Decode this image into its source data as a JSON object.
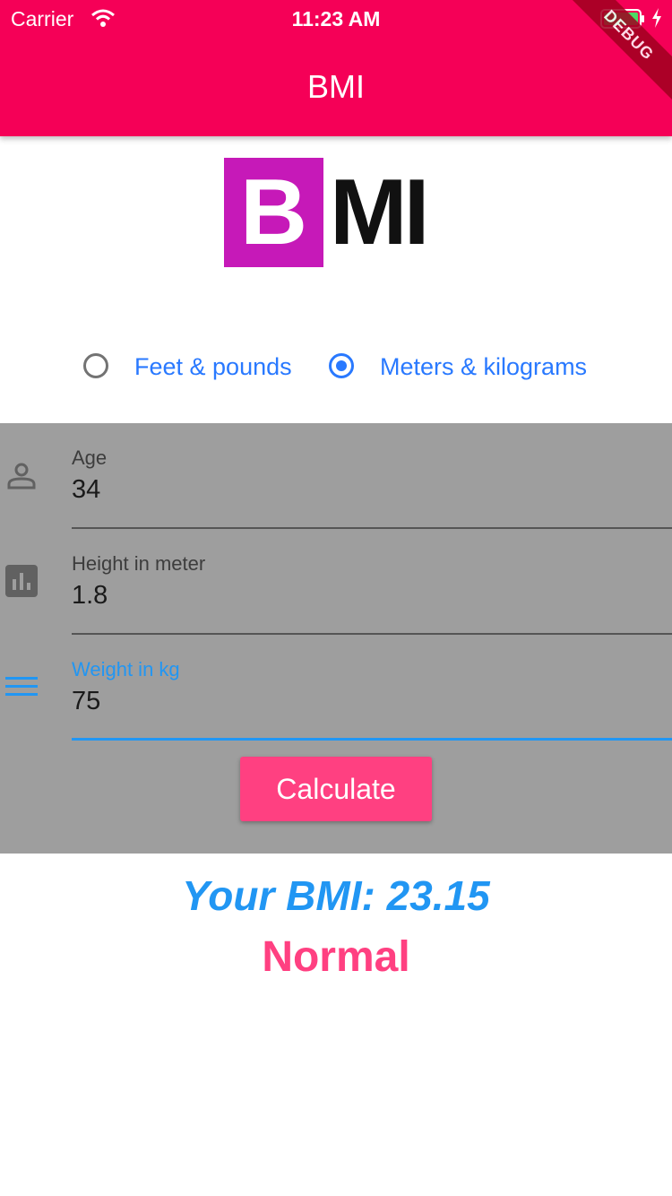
{
  "status_bar": {
    "carrier": "Carrier",
    "time": "11:23 AM"
  },
  "app_bar": {
    "title": "BMI",
    "debug_banner": "DEBUG",
    "color": "#f50057"
  },
  "logo": {
    "letter_boxed": "B",
    "letters": "MI",
    "box_color": "#c619b8"
  },
  "units": {
    "options": [
      {
        "label": "Feet & pounds",
        "selected": false
      },
      {
        "label": "Meters & kilograms",
        "selected": true
      }
    ],
    "accent": "#2979ff"
  },
  "form": {
    "background": "#9e9e9e",
    "fields": [
      {
        "label": "Age",
        "value": "34",
        "icon": "person-icon"
      },
      {
        "label": "Height in meter",
        "value": "1.8",
        "icon": "bar-chart-icon"
      },
      {
        "label": "Weight in kg",
        "value": "75",
        "icon": "menu-lines-icon",
        "focused": true
      }
    ],
    "calculate_label": "Calculate"
  },
  "result": {
    "bmi_text": "Your BMI: 23.15",
    "category": "Normal",
    "bmi_color": "#2196f3",
    "category_color": "#ff4081"
  }
}
